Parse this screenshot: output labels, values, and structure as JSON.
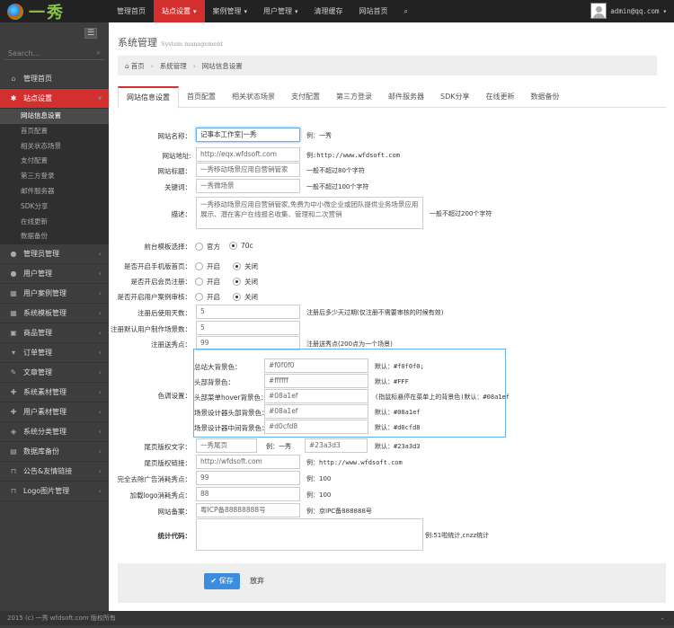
{
  "logo": {
    "text": "一秀"
  },
  "topnav": [
    {
      "label": "管理首页",
      "active": false
    },
    {
      "label": "站点设置",
      "active": true,
      "caret": true
    },
    {
      "label": "案例管理",
      "active": false,
      "caret": true
    },
    {
      "label": "用户管理",
      "active": false,
      "caret": true
    },
    {
      "label": "清理缓存",
      "active": false
    },
    {
      "label": "网站首页",
      "active": false
    }
  ],
  "user": {
    "email": "admin@qq.com",
    "caret": "▾"
  },
  "sidebar": {
    "search_placeholder": "Search...",
    "items": [
      {
        "label": "管理首页",
        "icon": "home-icon",
        "glyph": "⌂"
      },
      {
        "label": "站点设置",
        "icon": "gears-icon",
        "glyph": "✱",
        "active": true,
        "arrow": "▾"
      },
      {
        "label": "管理员管理",
        "icon": "user-icon",
        "glyph": "●",
        "arrow": "‹"
      },
      {
        "label": "用户管理",
        "icon": "user-icon",
        "glyph": "●",
        "arrow": "‹"
      },
      {
        "label": "用户案例管理",
        "icon": "grid-icon",
        "glyph": "▦",
        "arrow": "‹"
      },
      {
        "label": "系统模板管理",
        "icon": "grid-icon",
        "glyph": "▦",
        "arrow": "‹"
      },
      {
        "label": "商品管理",
        "icon": "square-icon",
        "glyph": "▣",
        "arrow": "‹"
      },
      {
        "label": "订单管理",
        "icon": "cart-icon",
        "glyph": "▾",
        "arrow": "‹"
      },
      {
        "label": "文章管理",
        "icon": "doc-icon",
        "glyph": "✎",
        "arrow": "‹"
      },
      {
        "label": "系统素材管理",
        "icon": "gift-icon",
        "glyph": "✚",
        "arrow": "‹"
      },
      {
        "label": "用户素材管理",
        "icon": "gift-icon",
        "glyph": "✚",
        "arrow": "‹"
      },
      {
        "label": "系统分类管理",
        "icon": "tag-icon",
        "glyph": "◈",
        "arrow": "‹"
      },
      {
        "label": "数据库备份",
        "icon": "list-icon",
        "glyph": "▤",
        "arrow": "‹"
      },
      {
        "label": "公告&友情链接",
        "icon": "bookmark-icon",
        "glyph": "⊓",
        "arrow": "‹"
      },
      {
        "label": "Logo图片管理",
        "icon": "bookmark-icon",
        "glyph": "⊓",
        "arrow": "‹"
      }
    ],
    "subitems": [
      {
        "label": "网站信息设置",
        "active": true
      },
      {
        "label": "首页配置"
      },
      {
        "label": "相关状态场景"
      },
      {
        "label": "支付配置"
      },
      {
        "label": "第三方登录"
      },
      {
        "label": "邮件服务器"
      },
      {
        "label": "SDK分享"
      },
      {
        "label": "在线更新"
      },
      {
        "label": "数据备份"
      }
    ]
  },
  "page": {
    "title": "系统管理",
    "subtitle": "System management"
  },
  "breadcrumb": {
    "home": "首页",
    "level1": "系统管理",
    "level2": "网站信息设置",
    "sep": "›",
    "home_icon": "⌂"
  },
  "tabs": [
    "网站信息设置",
    "首页配置",
    "相关状态场景",
    "支付配置",
    "第三方登录",
    "邮件服务器",
    "SDK分享",
    "在线更新",
    "数据备份"
  ],
  "form": {
    "site_name": {
      "label": "网站名称：",
      "value": "记事本工作室|一秀",
      "hint": "例：一秀"
    },
    "site_url": {
      "label": "网站地址:",
      "placeholder": "http://eqx.wfdsoft.com",
      "hint": "例:http://www.wfdsoft.com"
    },
    "site_title": {
      "label": "网站标题：",
      "placeholder": "一秀移动场景应用自营销管家",
      "hint": "一般不超过80个字符"
    },
    "keywords": {
      "label": "关键词：",
      "placeholder": "一秀微场景",
      "hint": "一般不超过100个字符"
    },
    "description": {
      "label": "描述：",
      "placeholder": "一秀移动场景应用自营销管家,免费为中小微企业或团队提供业务场景应用展示、潜在客户在线报名收集、管理和二次营销",
      "hint": "一般不超过200个字符"
    },
    "template": {
      "label": "前台模板选择：",
      "options": [
        "官方",
        "70c"
      ],
      "selected": 1
    },
    "mobile_home": {
      "label": "是否开启手机版首页：",
      "options": [
        "开启",
        "关闭"
      ],
      "selected": 1
    },
    "member_reg": {
      "label": "是否开启会员注册：",
      "options": [
        "开启",
        "关闭"
      ],
      "selected": 1
    },
    "case_review": {
      "label": "是否开启用户案例审核：",
      "options": [
        "开启",
        "关闭"
      ],
      "selected": 1
    },
    "reg_days": {
      "label": "注册后使用天数：",
      "value": "5",
      "hint": "注册后多少天过期(仅注册不需要审核的时候有效)"
    },
    "default_scenes": {
      "label": "注册默认用户制作场景数：",
      "value": "5"
    },
    "reg_points": {
      "label": "注册送秀点：",
      "value": "99",
      "hint": "注册送秀点(200点为一个场景)"
    },
    "colors": {
      "label": "色调设置：",
      "rows": [
        {
          "label": "总站大背景色：",
          "value": "#f0f0f0",
          "hint": "默认：#f0f0f0;"
        },
        {
          "label": "头部背景色：",
          "value": "#ffffff",
          "hint": "默认：#FFF"
        },
        {
          "label": "头部菜单hover背景色：",
          "value": "#08a1ef",
          "hint": "(指鼠标悬停在菜单上的背景色)默认：#08a1ef"
        },
        {
          "label": "场景设计器头部背景色：",
          "value": "#08a1ef",
          "hint": "默认：#08a1ef"
        },
        {
          "label": "场景设计器中间背景色：",
          "value": "#d0cfd8",
          "hint": "默认：#d0cfd8"
        }
      ]
    },
    "copyright_text": {
      "label": "尾页版权文字：",
      "value": "一秀尾页",
      "hint": "例：一秀",
      "color": "#23a3d3",
      "color_hint": "默认：#23a3d3"
    },
    "copyright_link": {
      "label": "尾页版权链接：",
      "placeholder": "http://wfdsoft.com",
      "hint": "例：http://www.wfdsoft.com"
    },
    "remove_ads": {
      "label": "完全去除广告消耗秀点：",
      "placeholder": "99",
      "hint": "例：100"
    },
    "logo_cost": {
      "label": "加载logo消耗秀点：",
      "placeholder": "88",
      "hint": "例：100"
    },
    "icp": {
      "label": "网站备案：",
      "placeholder": "粤ICP备88888888号",
      "hint": "例：京IPC备888888号"
    },
    "stats": {
      "label": "统计代码：",
      "hint": "例:51啦统计,cnzz统计"
    }
  },
  "buttons": {
    "save": "保存",
    "save_icon": "✔",
    "cancel": "放弃"
  },
  "footer": {
    "text": "2015 (c) 一秀 wfdsoft.com 版权所有",
    "totop": "⌃"
  },
  "colors_ui": {
    "accent": "#d32f2f",
    "primary": "#3c8dde",
    "focus": "#66afe9"
  }
}
